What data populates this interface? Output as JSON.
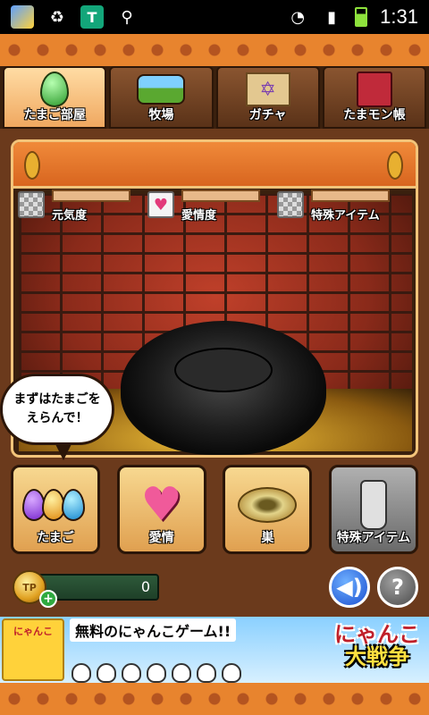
{
  "status_bar": {
    "time": "1:31",
    "icons": [
      "app-icon",
      "recycle-icon",
      "shield-icon",
      "usb-icon",
      "wifi-icon",
      "signal-icon",
      "battery-icon"
    ]
  },
  "tabs": [
    {
      "label": "たまご部屋",
      "icon": "egg-nest-icon",
      "active": true
    },
    {
      "label": "牧場",
      "icon": "farm-icon",
      "active": false
    },
    {
      "label": "ガチャ",
      "icon": "gacha-scroll-icon",
      "active": false
    },
    {
      "label": "たまモン帳",
      "icon": "book-icon",
      "active": false
    }
  ],
  "stats": [
    {
      "label": "元気度",
      "icon": "empty-slot-icon",
      "value": 0
    },
    {
      "label": "愛情度",
      "icon": "heart-flower-icon",
      "value": 0
    },
    {
      "label": "特殊アイテム",
      "icon": "empty-slot-icon",
      "value": 0
    }
  ],
  "speech_bubble": {
    "line1": "まずはたまごを",
    "line2": "えらんで！"
  },
  "buttons": [
    {
      "label": "たまご",
      "icon": "eggs-icon"
    },
    {
      "label": "愛情",
      "icon": "hearts-icon"
    },
    {
      "label": "巣",
      "icon": "nest-icon"
    },
    {
      "label": "特殊アイテム",
      "icon": "bottle-icon",
      "disabled": true
    }
  ],
  "coins": {
    "value": "0",
    "coin_text": "TP",
    "plus": "+"
  },
  "controls": {
    "sound_icon": "speaker-icon",
    "help_label": "?"
  },
  "ad": {
    "logo_text": "にゃんこ",
    "headline": "無料のにゃんこゲーム!!",
    "title_line1": "にゃんこ",
    "title_line2": "大戦争"
  },
  "colors": {
    "accent_orange": "#e8842e",
    "frame_border": "#f3c47a",
    "background_brown": "#6b3a1c"
  }
}
